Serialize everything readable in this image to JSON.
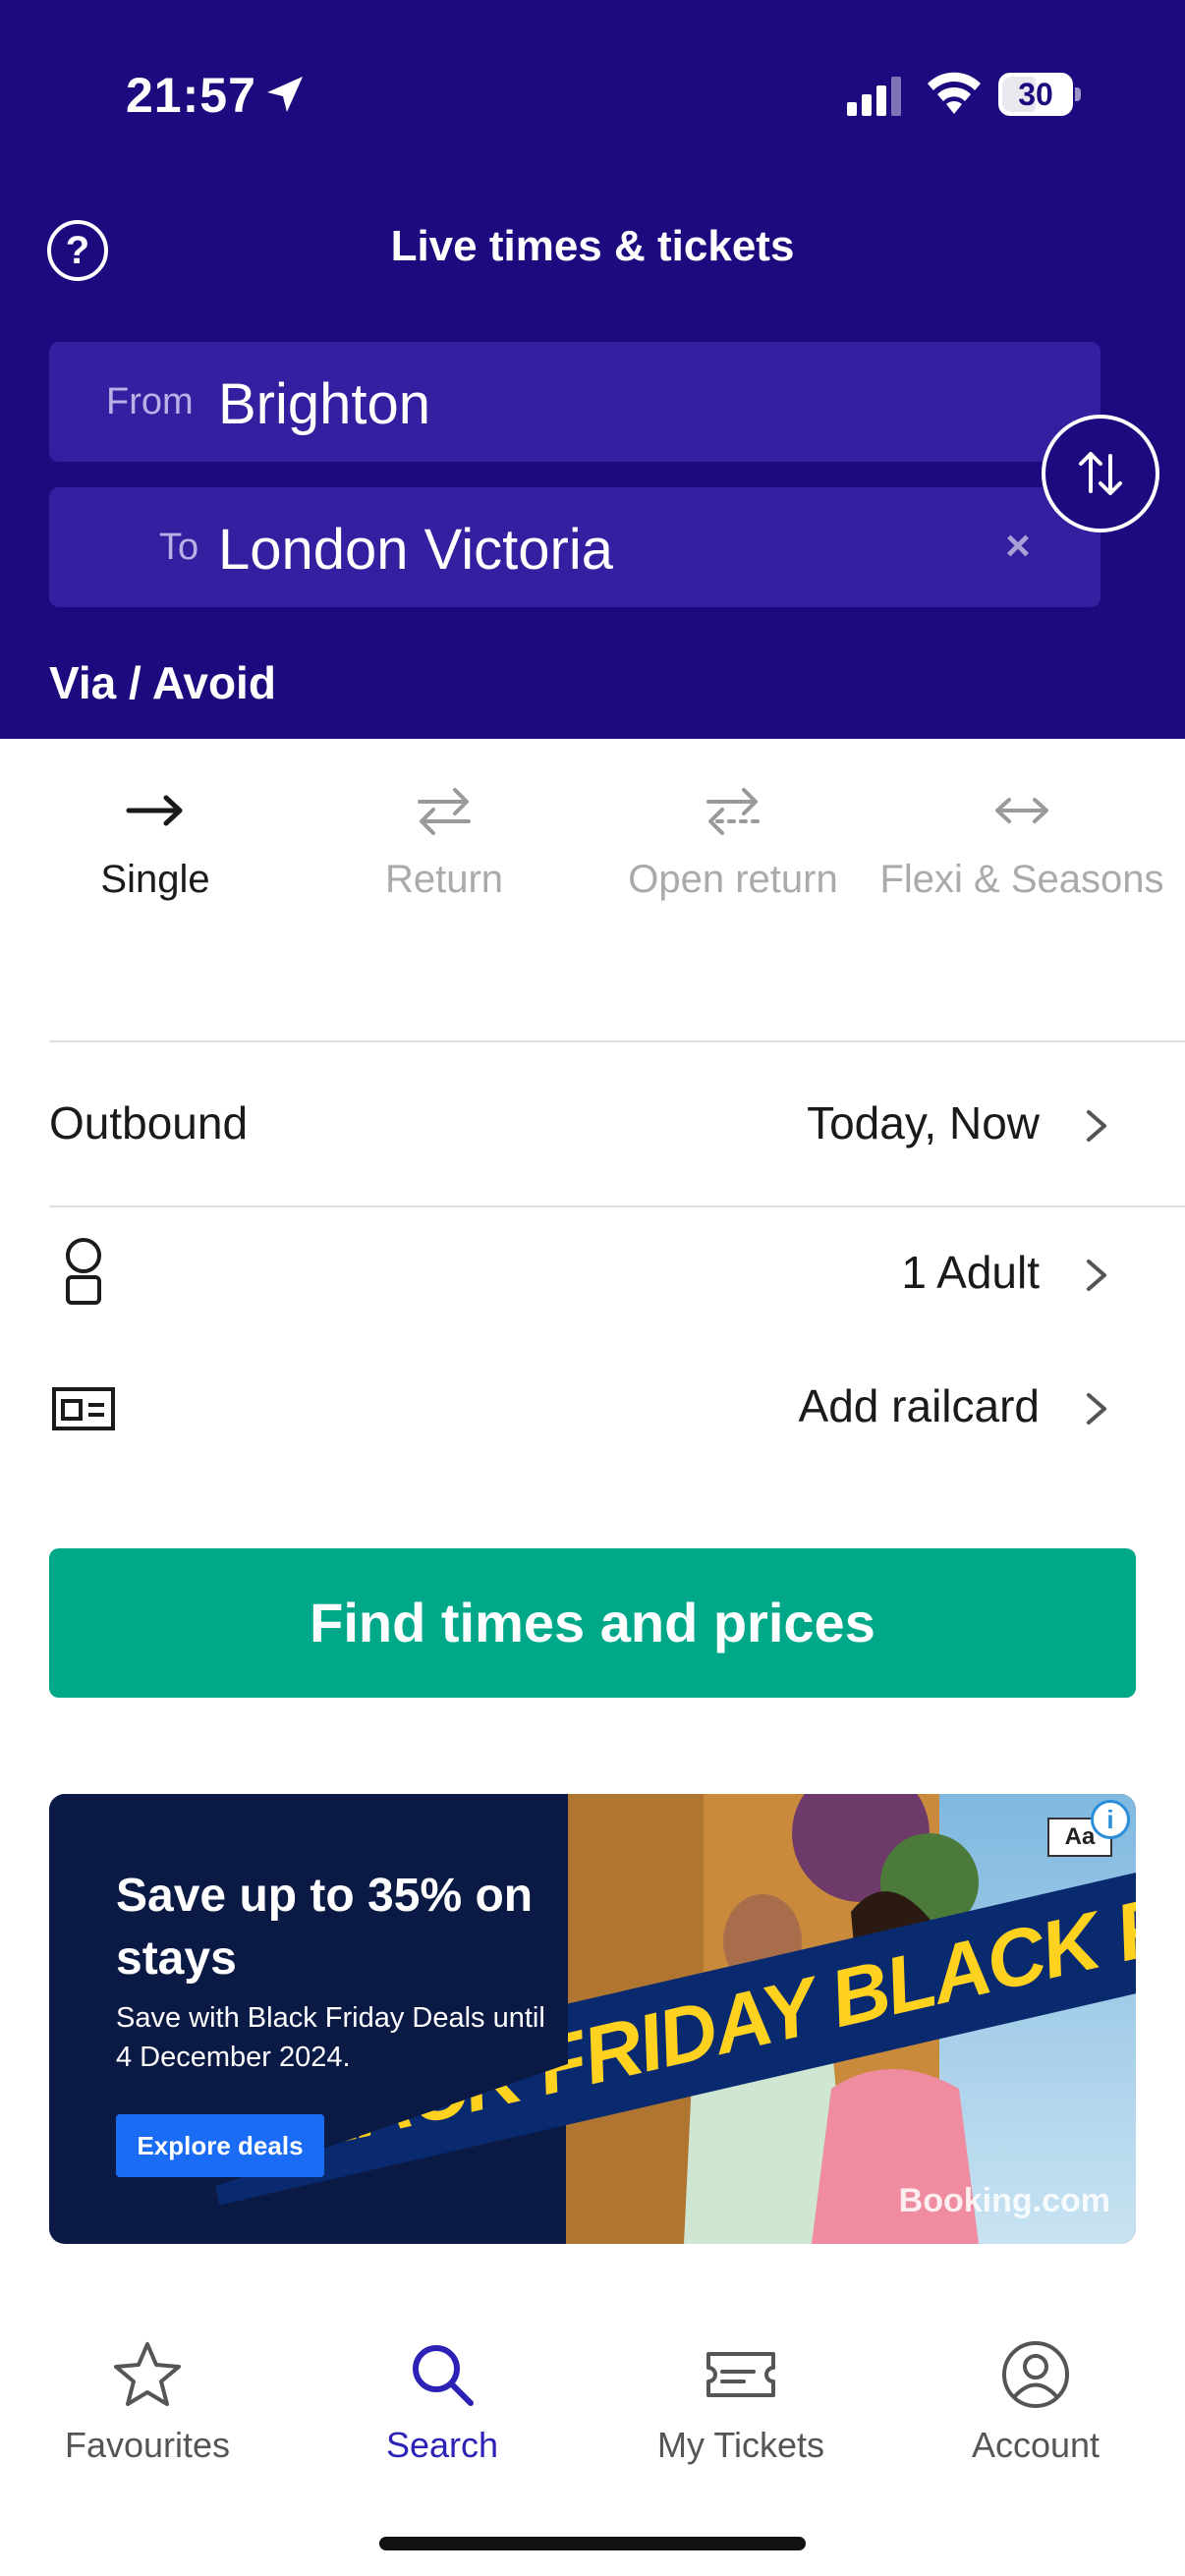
{
  "status_bar": {
    "time": "21:57",
    "battery_level": "30"
  },
  "header": {
    "title": "Live times & tickets",
    "help_icon": "question-circle-icon",
    "from": {
      "label": "From",
      "value": "Brighton"
    },
    "to": {
      "label": "To",
      "value": "London Victoria"
    },
    "clear_icon": "x-icon",
    "swap_icon": "swap-vertical-icon",
    "via_avoid": "Via / Avoid"
  },
  "journey_tabs": [
    {
      "label": "Single",
      "icon": "arrow-right-icon",
      "active": true
    },
    {
      "label": "Return",
      "icon": "arrows-return-icon",
      "active": false
    },
    {
      "label": "Open return",
      "icon": "arrows-open-return-icon",
      "active": false
    },
    {
      "label": "Flexi & Seasons",
      "icon": "arrow-left-right-icon",
      "active": false
    }
  ],
  "options": {
    "outbound": {
      "label": "Outbound",
      "value": "Today, Now"
    },
    "passengers": {
      "value": "1 Adult",
      "icon": "person-icon"
    },
    "railcard": {
      "value": "Add railcard",
      "icon": "railcard-icon"
    }
  },
  "cta": {
    "label": "Find times and prices"
  },
  "ad": {
    "headline": "Save up to 35% on stays",
    "subtext": "Save with Black Friday Deals until 4 December 2024.",
    "button": "Explore deals",
    "banner_text": "BLACK FRIDAY BLACK FRIDAY BLACK",
    "brand": "Booking.com",
    "choices": "Aa",
    "info": "i"
  },
  "bottom_nav": [
    {
      "label": "Favourites",
      "icon": "star-icon",
      "active": false
    },
    {
      "label": "Search",
      "icon": "search-icon",
      "active": true
    },
    {
      "label": "My Tickets",
      "icon": "ticket-icon",
      "active": false
    },
    {
      "label": "Account",
      "icon": "account-icon",
      "active": false
    }
  ],
  "colors": {
    "header_bg": "#1d0a7e",
    "field_bg": "#3320a0",
    "cta_bg": "#00a88a",
    "active_nav": "#2d22b6"
  }
}
